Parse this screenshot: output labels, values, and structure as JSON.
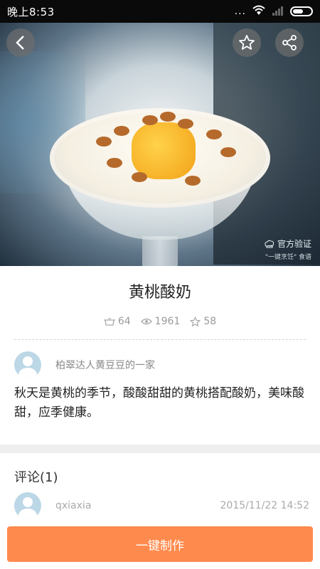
{
  "status_bar": {
    "time": "晚上8:53",
    "dots": "..."
  },
  "hero": {
    "verify_main": "官方验证",
    "verify_sub": "\"一键烹饪\" 食谱"
  },
  "recipe": {
    "title": "黄桃酸奶",
    "stats": {
      "cooked": "64",
      "views": "1961",
      "favorites": "58"
    },
    "author": "柏翠达人黄豆豆的一家",
    "description": "秋天是黄桃的季节，酸酸甜甜的黄桃搭配酸奶，美味酸甜，应季健康。"
  },
  "comments": {
    "title": "评论(1)",
    "items": [
      {
        "user": "qxiaxia",
        "time": "2015/11/22 14:52"
      }
    ]
  },
  "action": {
    "make_label": "一键制作"
  },
  "colors": {
    "accent": "#ff8a4d",
    "status_bar": "#0a0a0a",
    "band": "#eeeeee"
  }
}
